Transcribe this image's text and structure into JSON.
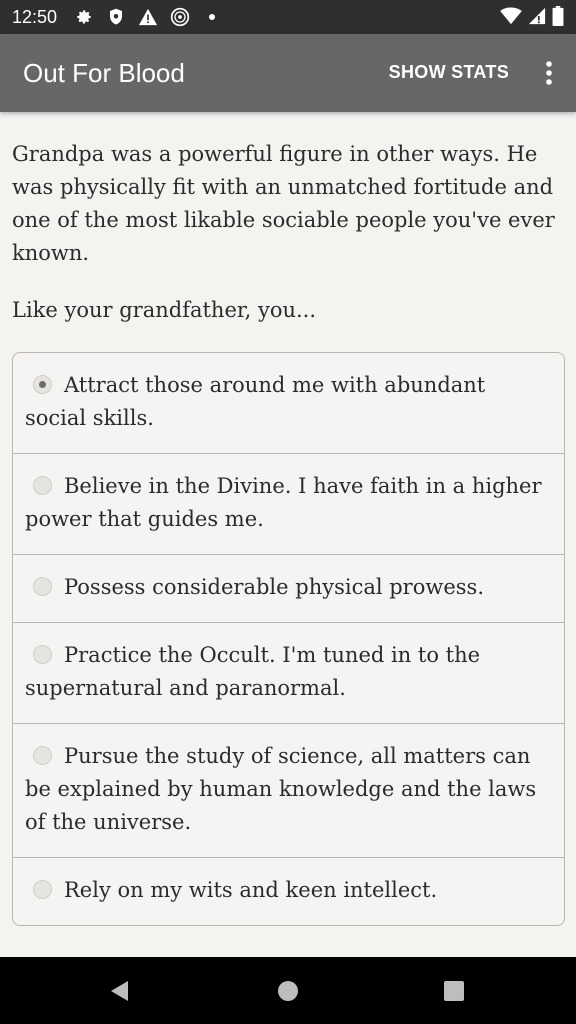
{
  "status_bar": {
    "time": "12:50",
    "icons": [
      "gear-icon",
      "shield-icon",
      "warning-icon",
      "globe-icon",
      "dot-icon",
      "wifi-icon",
      "signal-icon",
      "battery-icon"
    ]
  },
  "app_bar": {
    "title": "Out For Blood",
    "show_stats_label": "SHOW STATS",
    "overflow_icon": "more-vert-icon"
  },
  "story": {
    "paragraph": "Grandpa was a powerful figure in other ways. He was physically fit with an unmatched fortitude and one of the most likable sociable people you've ever known.",
    "prompt": "Like your grandfather, you..."
  },
  "choices": [
    {
      "label": "Attract those around me with abundant social skills.",
      "selected": true
    },
    {
      "label": "Believe in the Divine. I have faith in a higher power that guides me.",
      "selected": false
    },
    {
      "label": "Possess considerable physical prowess.",
      "selected": false
    },
    {
      "label": "Practice the Occult. I'm tuned in to the supernatural and paranormal.",
      "selected": false
    },
    {
      "label": "Pursue the study of science, all matters can be explained by human knowledge and the laws of the universe.",
      "selected": false
    },
    {
      "label": "Rely on my wits and keen intellect.",
      "selected": false
    }
  ],
  "nav_bar": {
    "icons": [
      "back-icon",
      "home-icon",
      "recents-icon"
    ]
  },
  "colors": {
    "status_bar": "#2f2f2f",
    "app_bar": "#676765",
    "background": "#f5f3f0",
    "text": "#2b2b2b",
    "border": "#b9b6b3"
  }
}
